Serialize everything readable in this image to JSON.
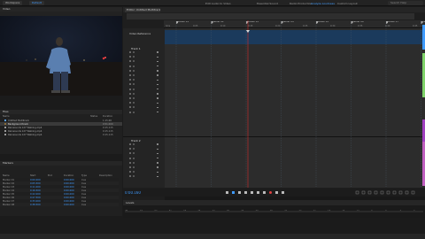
{
  "topbar": {
    "workspaces": [
      "Workspace",
      "Default"
    ],
    "menu": [
      "Edit Audio to Video",
      "Essential Sound",
      "Radio Production",
      "Analyze Loudness",
      "Custom Layout"
    ],
    "active_menu_index": 3,
    "search_placeholder": "Search Help"
  },
  "video_panel": {
    "title": "Video"
  },
  "files_panel": {
    "title": "Files",
    "columns": [
      "Name",
      "Status",
      "Duration"
    ],
    "rows": [
      {
        "name": "Untitled Multitrack",
        "duration": "1:15.68",
        "selected": false,
        "accent": "#5aa0e6"
      },
      {
        "name": "Background track",
        "duration": "0:51.000",
        "selected": true,
        "accent": "#8a6d3b"
      },
      {
        "name": "Rainsounds 127 Walking.mp4",
        "duration": "0:15.115",
        "selected": false,
        "accent": "#999999"
      },
      {
        "name": "Rainsounds 127 Walking.mp4",
        "duration": "0:15.115",
        "selected": false,
        "accent": "#999999"
      },
      {
        "name": "Rainsounds 127 Walking.mp4",
        "duration": "0:15.115",
        "selected": false,
        "accent": "#999999"
      }
    ]
  },
  "assets_panel": {
    "title": "Markers",
    "columns": [
      "Name",
      "Start",
      "End",
      "Duration",
      "Type",
      "Description"
    ],
    "rows": [
      {
        "name": "Marker 01",
        "start": "0:00.000",
        "end": "",
        "duration": "0:00.000",
        "type": "Cue"
      },
      {
        "name": "Marker 02",
        "start": "0:05.500",
        "end": "",
        "duration": "0:00.000",
        "type": "Cue"
      },
      {
        "name": "Marker 03",
        "start": "0:11.000",
        "end": "",
        "duration": "0:00.000",
        "type": "Cue"
      },
      {
        "name": "Marker 04",
        "start": "0:16.500",
        "end": "",
        "duration": "0:00.000",
        "type": "Cue"
      },
      {
        "name": "Marker 05",
        "start": "0:22.000",
        "end": "",
        "duration": "0:00.000",
        "type": "Cue"
      },
      {
        "name": "Marker 06",
        "start": "0:27.500",
        "end": "",
        "duration": "0:00.000",
        "type": "Cue"
      },
      {
        "name": "Marker 07",
        "start": "0:33.000",
        "end": "",
        "duration": "0:00.000",
        "type": "Cue"
      },
      {
        "name": "Marker 08",
        "start": "0:38.500",
        "end": "",
        "duration": "0:00.000",
        "type": "Cue"
      }
    ]
  },
  "editor": {
    "tab_label": "Editor: Untitled Multitrack *",
    "markers": [
      "Marker 01",
      "Marker 02",
      "Marker 03",
      "Marker 04",
      "Marker 05",
      "Marker 06",
      "Marker 07",
      "Marker 08"
    ],
    "ruler_ticks": [
      "hms",
      "0:05",
      "0:10",
      "0:15",
      "0:20",
      "0:25",
      "0:30",
      "0:35",
      "0:40",
      "0:45"
    ],
    "video_track_label": "Video Reference",
    "track1_name": "Track 1",
    "track2_name": "Track 2",
    "timecode": "0:00.160"
  },
  "levels": {
    "title": "Levels",
    "scale": [
      "dB",
      "-57",
      "-54",
      "-51",
      "-48",
      "-45",
      "-42",
      "-39",
      "-36",
      "-33",
      "-30",
      "-27",
      "-24",
      "-21",
      "-18",
      "-15",
      "-12",
      "-9",
      "-6",
      "-3",
      "0"
    ]
  },
  "colors": {
    "accent": "#3f9bff",
    "marker_lane": "#1b3a5c",
    "track_area": "#2c2c2c",
    "playhead": "#d33030"
  }
}
